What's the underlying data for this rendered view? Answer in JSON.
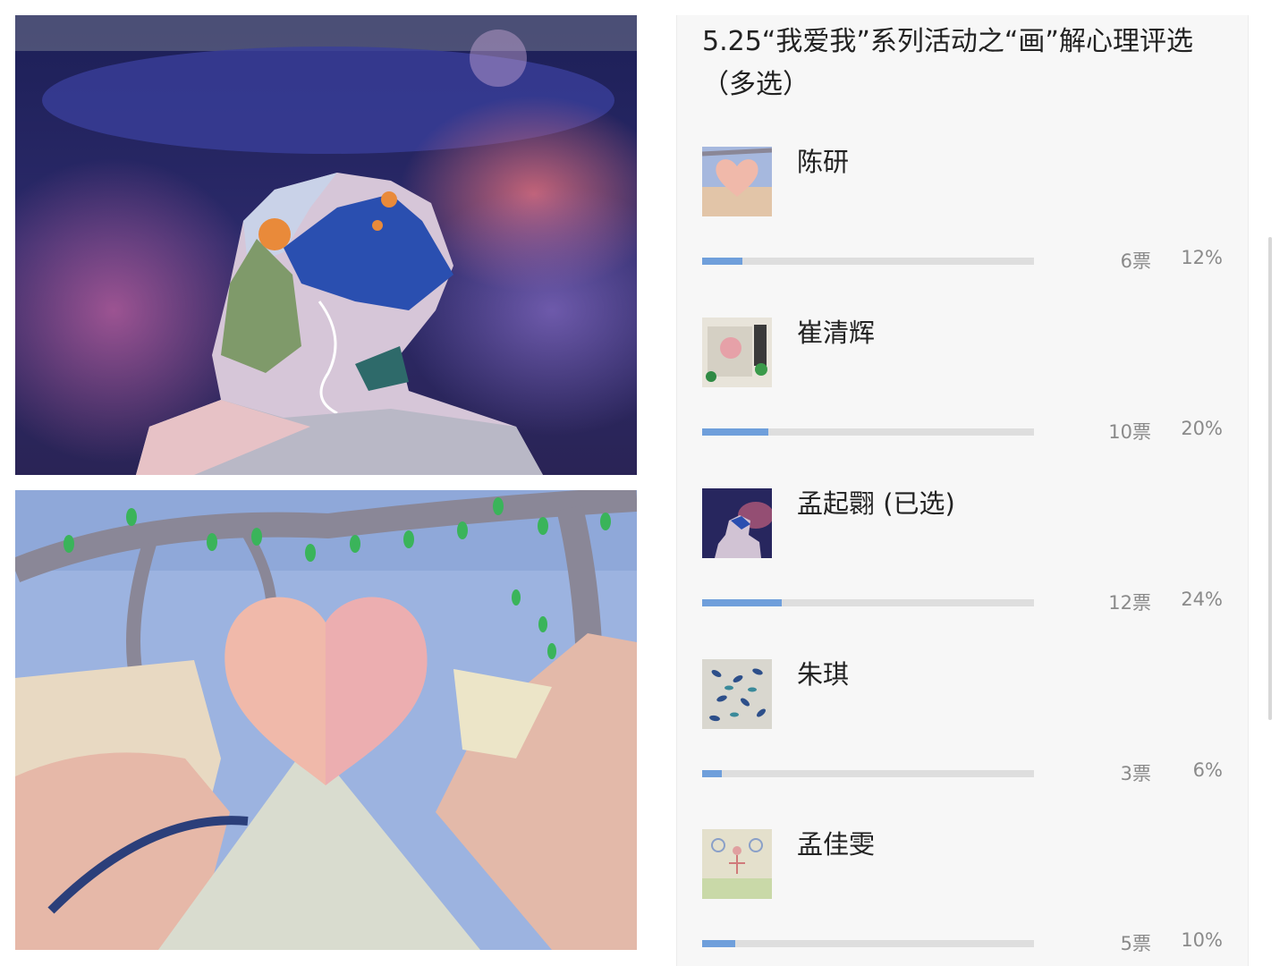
{
  "poll": {
    "title": "5.25“我爱我”系列活动之“画”解心理评选（多选）",
    "options": [
      {
        "name": "陈研",
        "votes": "6票",
        "percent": "12%",
        "fraction": 0.12
      },
      {
        "name": "崔清辉",
        "votes": "10票",
        "percent": "20%",
        "fraction": 0.2
      },
      {
        "name": "孟起翾 (已选)",
        "votes": "12票",
        "percent": "24%",
        "fraction": 0.24
      },
      {
        "name": "朱琪",
        "votes": "3票",
        "percent": "6%",
        "fraction": 0.06
      },
      {
        "name": "孟佳雯",
        "votes": "5票",
        "percent": "10%",
        "fraction": 0.1
      }
    ]
  },
  "colors": {
    "bar_fill": "#6f9fdb",
    "bar_track": "#dedede",
    "panel_bg": "#f7f7f7"
  }
}
